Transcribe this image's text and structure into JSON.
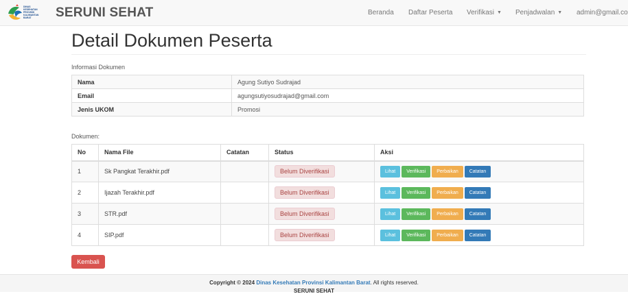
{
  "navbar": {
    "logo_text": [
      "DINAS",
      "KESEHATAN",
      "PROVINSI",
      "KALIMANTAN",
      "BARAT"
    ],
    "brand": "SERUNI SEHAT",
    "items": [
      "Beranda",
      "Daftar Peserta",
      "Verifikasi",
      "Penjadwalan"
    ],
    "user": "admin@gmail.com"
  },
  "page": {
    "title": "Detail Dokumen Peserta"
  },
  "info": {
    "section_label": "Informasi Dokumen",
    "rows": [
      {
        "label": "Nama",
        "value": "Agung Sutiyo Sudrajad"
      },
      {
        "label": "Email",
        "value": "agungsutiyosudrajad@gmail.com"
      },
      {
        "label": "Jenis UKOM",
        "value": "Promosi"
      }
    ]
  },
  "documents": {
    "section_label": "Dokumen:",
    "headers": {
      "no": "No",
      "name": "Nama File",
      "note": "Catatan",
      "status": "Status",
      "action": "Aksi"
    },
    "rows": [
      {
        "no": "1",
        "name": "Sk Pangkat Terakhir.pdf",
        "note": "",
        "status": "Belum Diverifikasi"
      },
      {
        "no": "2",
        "name": "Ijazah Terakhir.pdf",
        "note": "",
        "status": "Belum Diverifikasi"
      },
      {
        "no": "3",
        "name": "STR.pdf",
        "note": "",
        "status": "Belum Diverifikasi"
      },
      {
        "no": "4",
        "name": "SIP.pdf",
        "note": "",
        "status": "Belum Diverifikasi"
      }
    ],
    "actions": {
      "view": "Lihat",
      "verify": "Verifikasi",
      "fix": "Perbaikan",
      "note": "Catatan"
    }
  },
  "back_button": "Kembali",
  "footer": {
    "copyright_prefix": "Copyright © 2024",
    "org": "Dinas Kesehatan Provinsi Kalimantan Barat",
    "suffix": ". All rights reserved.",
    "app": "SERUNI SEHAT"
  },
  "colors": {
    "status_bg": "#f2dede",
    "status_text": "#a94442",
    "view": "#5bc0de",
    "verify": "#5cb85c",
    "fix": "#f0ad4e",
    "note": "#337ab7",
    "back": "#d9534f"
  }
}
